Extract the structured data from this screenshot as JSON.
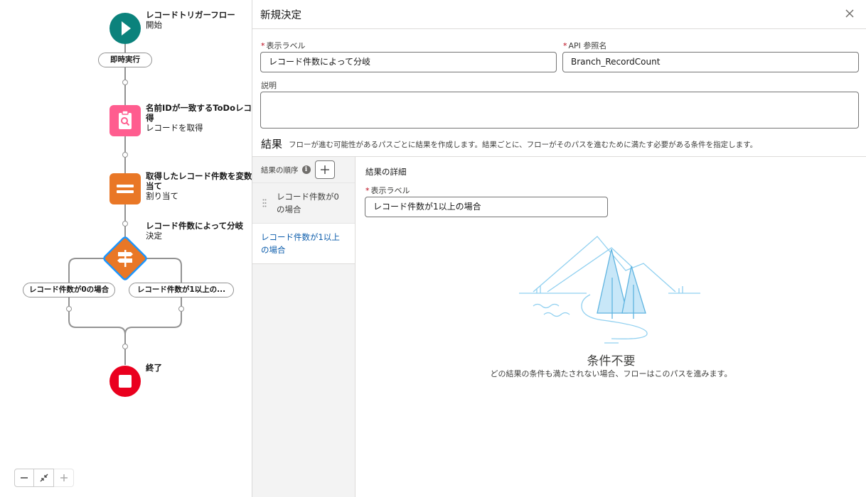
{
  "flow": {
    "start": {
      "title": "レコードトリガーフロー",
      "subtitle": "開始"
    },
    "run_pill": "即時実行",
    "get_records": {
      "title_line1": "名前IDが一致するToDoレコー",
      "title_line2": "得",
      "subtitle": "レコードを取得"
    },
    "assignment": {
      "title_line1": "取得したレコード件数を変数",
      "title_line2": "当て",
      "subtitle": "割り当て"
    },
    "decision": {
      "title": "レコード件数によって分岐",
      "subtitle": "決定"
    },
    "branches": [
      "レコード件数が0の場合",
      "レコード件数が1以上の..."
    ],
    "end": {
      "title": "終了"
    }
  },
  "zoom": {
    "zoom_out": "zoom-out",
    "fit": "fit-view",
    "zoom_in": "zoom-in"
  },
  "panel": {
    "title": "新規決定",
    "label_field": {
      "label": "表示ラベル",
      "value": "レコード件数によって分岐"
    },
    "api_field": {
      "label": "API 参照名",
      "value": "Branch_RecordCount"
    },
    "description_field": {
      "label": "説明",
      "value": ""
    },
    "outcomes": {
      "title": "結果",
      "description": "フローが進む可能性があるパスごとに結果を作成します。結果ごとに、フローがそのパスを進むために満たす必要がある条件を指定します。",
      "order_label": "結果の順序",
      "items": [
        {
          "label": "レコード件数が0の場合"
        },
        {
          "label": "レコード件数が1以上の場合"
        }
      ],
      "detail_title": "結果の詳細",
      "detail_label_field": {
        "label": "表示ラベル",
        "value": "レコード件数が1以上の場合"
      },
      "empty_title": "条件不要",
      "empty_desc": "どの結果の条件も満たされない場合、フローはこのパスを進みます。"
    }
  },
  "colors": {
    "start": "#0b827c",
    "get_records": "#ff5d8f",
    "assignment": "#e97726",
    "decision": "#e97726",
    "end": "#ea001e",
    "link": "#0b5cab"
  }
}
